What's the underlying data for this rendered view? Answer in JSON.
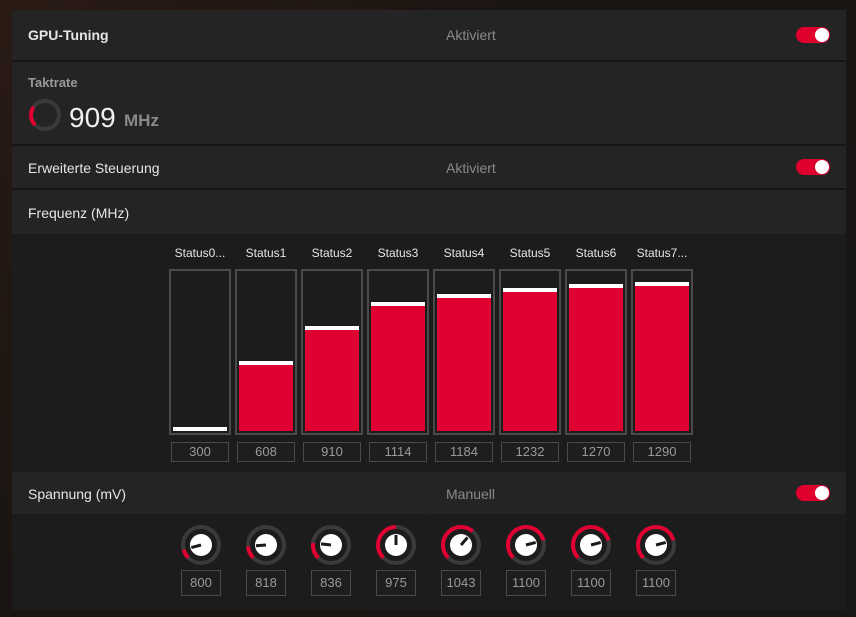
{
  "gpu_tuning": {
    "label": "GPU-Tuning",
    "status": "Aktiviert",
    "enabled": true
  },
  "clock": {
    "label": "Taktrate",
    "value": "909",
    "unit": "MHz",
    "gauge_fraction": 0.3
  },
  "advanced": {
    "label": "Erweiterte Steuerung",
    "status": "Aktiviert",
    "enabled": true
  },
  "frequency": {
    "label": "Frequenz (MHz)",
    "max": 1400,
    "states": [
      {
        "name": "Status0...",
        "value": "300"
      },
      {
        "name": "Status1",
        "value": "608"
      },
      {
        "name": "Status2",
        "value": "910"
      },
      {
        "name": "Status3",
        "value": "1114"
      },
      {
        "name": "Status4",
        "value": "1184"
      },
      {
        "name": "Status5",
        "value": "1232"
      },
      {
        "name": "Status6",
        "value": "1270"
      },
      {
        "name": "Status7...",
        "value": "1290"
      }
    ]
  },
  "voltage": {
    "label": "Spannung (mV)",
    "mode": "Manuell",
    "enabled": true,
    "min": 750,
    "max": 1200,
    "values": [
      "800",
      "818",
      "836",
      "975",
      "1043",
      "1100",
      "1100",
      "1100"
    ]
  },
  "colors": {
    "accent": "#e00032",
    "panel": "#242424"
  }
}
